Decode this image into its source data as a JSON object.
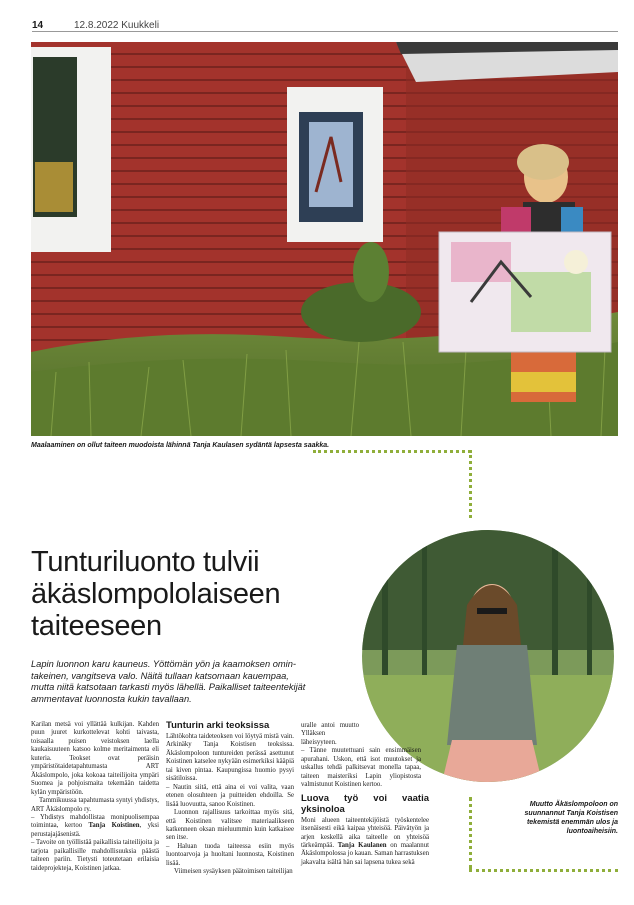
{
  "header": {
    "page_number": "14",
    "date_paper": "12.8.2022 Kuukkeli"
  },
  "photo1": {
    "caption": "Maalaaminen on ollut taiteen muodoista lähinnä Tanja Kaulasen sydäntä lapsesta saakka."
  },
  "article": {
    "headline": [
      "Tunturiluonto tulvii",
      "äkäslompololaiseen",
      "taiteeseen"
    ],
    "lead": [
      "Lapin luonnon karu kauneus. Yöttömän yön ja kaamoksen omin-",
      "takeinen, vangitseva valo. Näitä tullaan katsomaan kauempaa,",
      "mutta niitä katsotaan tarkasti myös lähellä. Paikalliset taiteentekijät",
      "ammentavat luonnosta kukin tavallaan."
    ],
    "col1": [
      "Karilan metsä voi yllättää kulkijan. Kahden puun juuret kurkottelevat kohti taivasta, toisaalla puisen veistoksen laella kaukaisuuteen katsoo kolme meritaimenta eli kuteria. Teokset ovat peräisin ympäristötaidetapahtumasta ART Äkäslompolo, joka kokoaa taiteilijoita ympäri Suomea ja pohjoismaita tekemään taidetta kylän ympäristöön.",
      "Tammikuussa tapahtumasta syntyi yhdistys, ART Äkäslompolo ry.",
      "– Yhdistys mahdollistaa monipuolisempaa toimintaa, kertoo {b}Tanja Koistinen{/b}, yksi perustajajäsenistä.",
      "– Tavoite on työllistää paikallisia taiteilijoita ja tarjota paikallisille mahdollisuuksia päästä taiteen pariin. Tietysti toteutetaan erilaisia taideprojekteja, Koistinen jatkaa."
    ],
    "col2_heading": "Tunturin arki teoksissa",
    "col2": [
      "Lähtökohta taideteoksen voi löytyä mistä vain. Arkinäky Tanja Koistisen teoksissa. Äkäslompoloon tuntureiden perässä asettunut Koistinen katselee nykyään esimerkiksi kääpiä tai kiven pintaa. Kaupungissa huomio pysyi sisätiloissa.",
      "– Nautin siitä, että aina ei voi valita, vaan etenen olosuhteen ja puitteiden ehdoilla. Se lisää luovuutta, sanoo Koistinen.",
      "Luonnon rajallisuus tarkoittaa myös sitä, että Koistinen valitsee materiaalikseen katkenneen oksan mieluummin kuin katkaisee sen itse.",
      "– Haluan tuoda taiteessa esiin myös luontoarvoja ja huoltani luonnosta, Koistinen lisää.",
      "Viimeisen sysäyksen päätoimisen taiteilijan"
    ],
    "col3_a": [
      "uralle antoi muutto Ylläksen läheisyyteen.",
      "– Tänne muutettuani sain ensimmäisen apurahani. Uskon, että isot muutokset ja uskallus tehdä palkitsevat monella tapaa, taiteen maisteriksi Lapin yliopistosta valmistunut Koistinen kertoo."
    ],
    "col3_heading": "Luova työ voi vaatia yksinoloa",
    "col3_b": [
      "Moni alueen taiteentekijöistä työskentelee itsenäisesti eikä kaipaa yhteisöä. Päivätyön ja arjen keskellä aika taiteelle on yhteisöä tärkeämpää. {b}Tanja Kaulanen{/b} on maalannut Äkäslompolossa jo kauan. Saman harrastuksen jakavalta isältä hän sai lapsena tukea sekä"
    ]
  },
  "photo2": {
    "caption": "Muutto Äkäslompoloon on suunnannut Tanja Koistisen tekemistä enemmän ulos ja luontoaiheisiin."
  },
  "colors": {
    "accent_dots": "#8fae3a",
    "barn_red": "#a3332c"
  }
}
